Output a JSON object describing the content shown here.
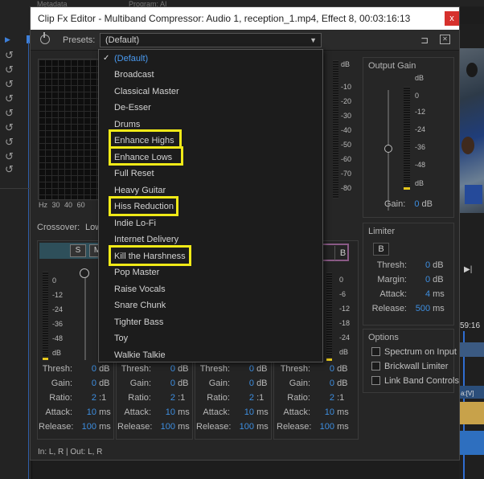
{
  "host": {
    "tab_metadata": "Metadata",
    "tab_program": "Program: AI",
    "timecode": "59:16",
    "clip_label": "a:[V]"
  },
  "dialog": {
    "title": "Clip Fx Editor - Multiband Compressor: Audio 1, reception_1.mp4, Effect 8, 00:03:16:13",
    "close_glyph": "x",
    "presets_label": "Presets:",
    "presets_value": "(Default)",
    "icons": [
      "power-icon",
      "route-icon",
      "close-panel-icon"
    ]
  },
  "graph": {
    "hz_labels": [
      "Hz",
      "30",
      "40",
      "60"
    ]
  },
  "meter_db_labels": [
    "dB",
    "-10",
    "-20",
    "-30",
    "-40",
    "-50",
    "-60",
    "-70",
    "-80"
  ],
  "output_gain": {
    "title": "Output Gain",
    "labels": [
      "dB",
      "0",
      "-12",
      "-24",
      "-36",
      "-48",
      "dB"
    ],
    "gain_label": "Gain:",
    "gain_value": "0",
    "gain_unit": "dB"
  },
  "limiter": {
    "title": "Limiter",
    "b_label": "B",
    "thresh_label": "Thresh:",
    "thresh_value": "0",
    "thresh_unit": "dB",
    "margin_label": "Margin:",
    "margin_value": "0",
    "margin_unit": "dB",
    "attack_label": "Attack:",
    "attack_value": "4",
    "attack_unit": "ms",
    "release_label": "Release:",
    "release_value": "500",
    "release_unit": "ms"
  },
  "options": {
    "title": "Options",
    "items": [
      "Spectrum on Input",
      "Brickwall Limiter",
      "Link Band Controls"
    ]
  },
  "crossover": {
    "label": "Crossover:",
    "value": "Low"
  },
  "bands": {
    "s_label": "S",
    "m_label": "M",
    "b_label": "B",
    "meter_labels": [
      "0",
      "-12",
      "-24",
      "-36",
      "-48",
      "dB"
    ],
    "band4_labels": [
      "0",
      "-6",
      "-12",
      "-18",
      "-24",
      "dB"
    ],
    "params": [
      {
        "thresh": "0",
        "gain": "0",
        "ratio": "2",
        "attack": "10",
        "release": "100"
      },
      {
        "thresh": "0",
        "gain": "0",
        "ratio": "2",
        "attack": "10",
        "release": "100"
      },
      {
        "thresh": "0",
        "gain": "0",
        "ratio": "2",
        "attack": "10",
        "release": "100"
      },
      {
        "thresh": "0",
        "gain": "0",
        "ratio": "2",
        "attack": "10",
        "release": "100"
      }
    ],
    "thresh_label": "Thresh:",
    "gain_label": "Gain:",
    "ratio_label": "Ratio:",
    "attack_label": "Attack:",
    "release_label": "Release:",
    "db_unit": "dB",
    "ratio_unit": ":1",
    "ms_unit": "ms"
  },
  "status": "In: L, R | Out: L, R",
  "dropdown": {
    "items": [
      {
        "label": "(Default)",
        "selected": true,
        "highlighted": false
      },
      {
        "label": "Broadcast",
        "selected": false,
        "highlighted": false
      },
      {
        "label": "Classical Master",
        "selected": false,
        "highlighted": false
      },
      {
        "label": "De-Esser",
        "selected": false,
        "highlighted": false
      },
      {
        "label": "Drums",
        "selected": false,
        "highlighted": false
      },
      {
        "label": "Enhance Highs",
        "selected": false,
        "highlighted": true
      },
      {
        "label": "Enhance Lows",
        "selected": false,
        "highlighted": true
      },
      {
        "label": "Full Reset",
        "selected": false,
        "highlighted": false
      },
      {
        "label": "Heavy Guitar",
        "selected": false,
        "highlighted": false
      },
      {
        "label": "Hiss Reduction",
        "selected": false,
        "highlighted": true
      },
      {
        "label": "Indie Lo-Fi",
        "selected": false,
        "highlighted": false
      },
      {
        "label": "Internet Delivery",
        "selected": false,
        "highlighted": false
      },
      {
        "label": "Kill the Harshness",
        "selected": false,
        "highlighted": true
      },
      {
        "label": "Pop Master",
        "selected": false,
        "highlighted": false
      },
      {
        "label": "Raise Vocals",
        "selected": false,
        "highlighted": false
      },
      {
        "label": "Snare Chunk",
        "selected": false,
        "highlighted": false
      },
      {
        "label": "Tighter Bass",
        "selected": false,
        "highlighted": false
      },
      {
        "label": "Toy",
        "selected": false,
        "highlighted": false
      },
      {
        "label": "Walkie Talkie",
        "selected": false,
        "highlighted": false
      }
    ],
    "check_glyph": "✓"
  },
  "colors": {
    "highlight_box": "#f0ea17",
    "value_blue": "#3d8ee0",
    "selected_blue": "#4a9af0",
    "close_red": "#d6312d",
    "meter_yellow": "#e6c81e"
  }
}
